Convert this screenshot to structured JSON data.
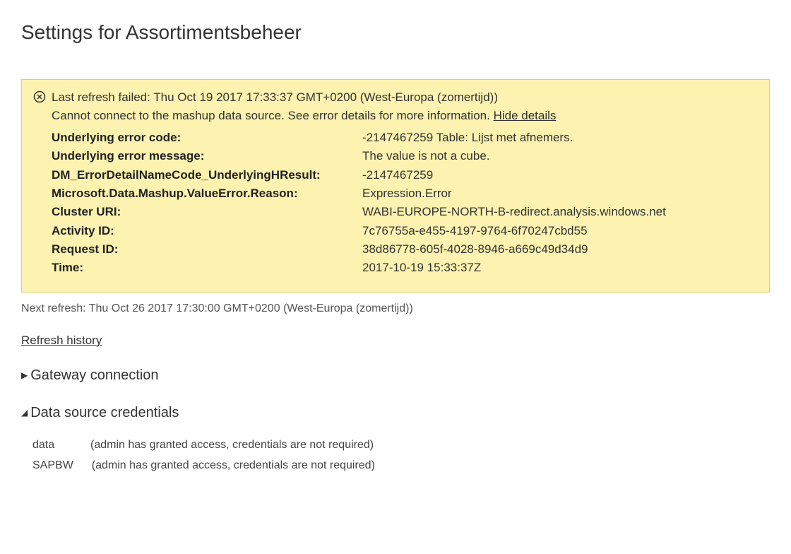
{
  "page_title": "Settings for Assortimentsbeheer",
  "error": {
    "title": "Last refresh failed: Thu Oct 19 2017 17:33:37 GMT+0200 (West-Europa (zomertijd))",
    "message": "Cannot connect to the mashup data source. See error details for more information.",
    "hide_details_label": "Hide details",
    "details": [
      {
        "label": "Underlying error code:",
        "value": "-2147467259 Table: Lijst met afnemers."
      },
      {
        "label": "Underlying error message:",
        "value": "The value is not a cube."
      },
      {
        "label": "DM_ErrorDetailNameCode_UnderlyingHResult:",
        "value": "-2147467259"
      },
      {
        "label": "Microsoft.Data.Mashup.ValueError.Reason:",
        "value": "Expression.Error"
      },
      {
        "label": "Cluster URI:",
        "value": "WABI-EUROPE-NORTH-B-redirect.analysis.windows.net"
      },
      {
        "label": "Activity ID:",
        "value": "7c76755a-e455-4197-9764-6f70247cbd55"
      },
      {
        "label": "Request ID:",
        "value": "38d86778-605f-4028-8946-a669c49d34d9"
      },
      {
        "label": "Time:",
        "value": "2017-10-19 15:33:37Z"
      }
    ]
  },
  "next_refresh": "Next refresh: Thu Oct 26 2017 17:30:00 GMT+0200 (West-Europa (zomertijd))",
  "refresh_history_label": "Refresh history",
  "sections": {
    "gateway_label": "Gateway connection",
    "credentials_label": "Data source credentials"
  },
  "credentials": [
    {
      "name": "data",
      "note": "(admin has granted access, credentials are not required)"
    },
    {
      "name": "SAPBW",
      "note": "(admin has granted access, credentials are not required)"
    }
  ]
}
